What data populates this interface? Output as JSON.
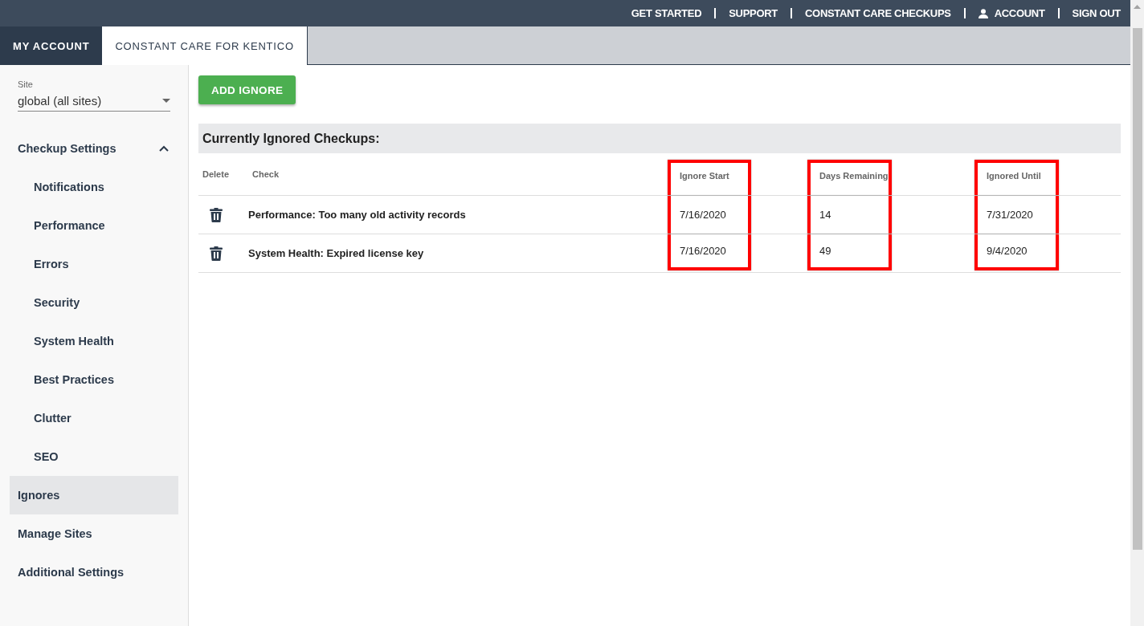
{
  "top_nav": [
    {
      "label": "GET STARTED",
      "kind": "link"
    },
    {
      "label": "SUPPORT",
      "kind": "link"
    },
    {
      "label": "CONSTANT CARE CHECKUPS",
      "kind": "link"
    },
    {
      "label": "ACCOUNT",
      "kind": "account"
    },
    {
      "label": "SIGN OUT",
      "kind": "link"
    }
  ],
  "tabs": [
    {
      "label": "MY ACCOUNT",
      "selected": false
    },
    {
      "label": "CONSTANT CARE FOR KENTICO",
      "selected": true
    }
  ],
  "sidebar": {
    "site": {
      "label": "Site",
      "value": "global (all sites)"
    },
    "items": [
      {
        "label": "Checkup Settings",
        "expanded": true,
        "selected": false,
        "children": [
          {
            "label": "Notifications",
            "selected": false
          },
          {
            "label": "Performance",
            "selected": false
          },
          {
            "label": "Errors",
            "selected": false
          },
          {
            "label": "Security",
            "selected": false
          },
          {
            "label": "System Health",
            "selected": false
          },
          {
            "label": "Best Practices",
            "selected": false
          },
          {
            "label": "Clutter",
            "selected": false
          },
          {
            "label": "SEO",
            "selected": false
          }
        ]
      },
      {
        "label": "Ignores",
        "selected": true
      },
      {
        "label": "Manage Sites",
        "selected": false
      },
      {
        "label": "Additional Settings",
        "selected": false
      }
    ]
  },
  "add_button": "ADD IGNORE",
  "section_title": "Currently Ignored Checkups:",
  "table": {
    "columns": [
      {
        "label": "Delete",
        "highlighted": false
      },
      {
        "label": "Check",
        "highlighted": false
      },
      {
        "label": "Ignore Start",
        "highlighted": true
      },
      {
        "label": "Days Remaining",
        "highlighted": true
      },
      {
        "label": "Ignored Until",
        "highlighted": true
      }
    ],
    "rows": [
      {
        "check": "Performance: Too many old activity records",
        "ignore_start": "7/16/2020",
        "days_remaining": "14",
        "ignored_until": "7/31/2020"
      },
      {
        "check": "System Health: Expired license key",
        "ignore_start": "7/16/2020",
        "days_remaining": "49",
        "ignored_until": "9/4/2020"
      }
    ]
  }
}
